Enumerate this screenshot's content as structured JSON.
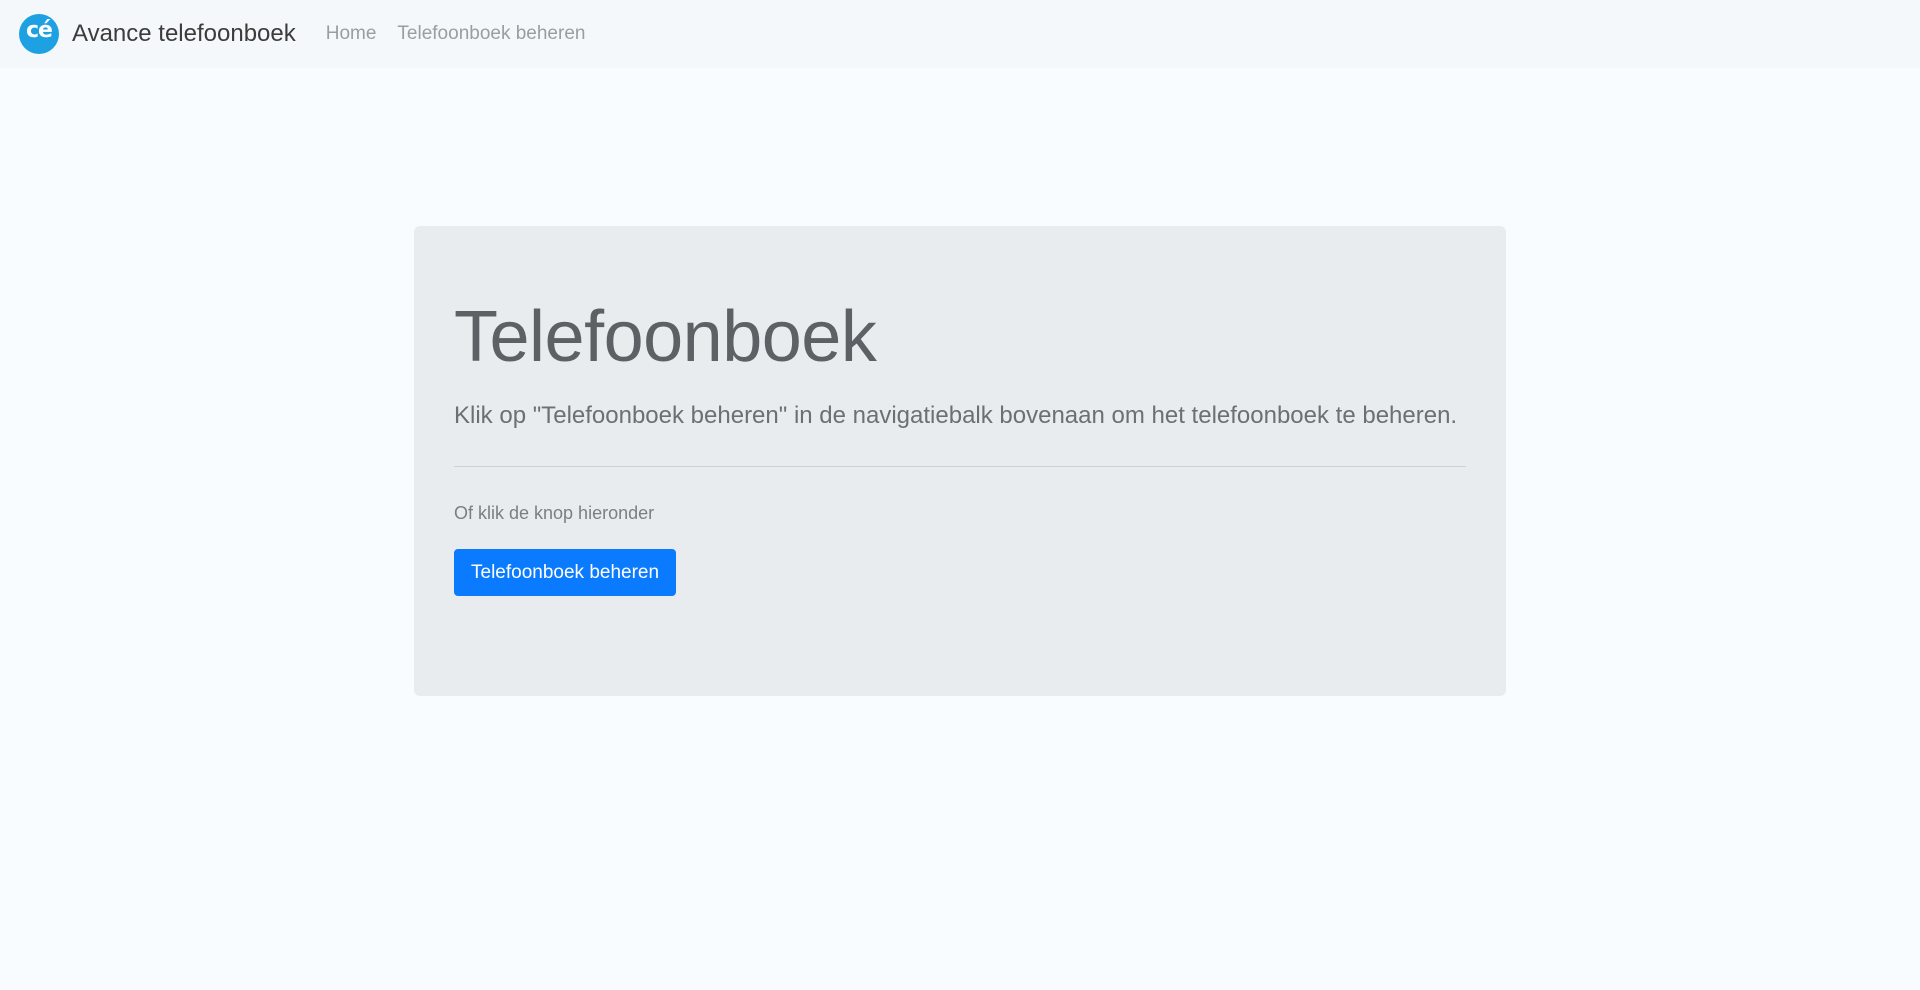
{
  "navbar": {
    "logo_text": "cé",
    "brand": "Avance telefoonboek",
    "links": [
      {
        "label": "Home"
      },
      {
        "label": "Telefoonboek beheren"
      }
    ]
  },
  "jumbotron": {
    "title": "Telefoonboek",
    "lead": "Klik op \"Telefoonboek beheren\" in de navigatiebalk bovenaan om het telefoonboek te beheren.",
    "hint": "Of klik de knop hieronder",
    "button_label": "Telefoonboek beheren"
  },
  "colors": {
    "logo": "#1da1e2",
    "primary_button": "#0a7bff",
    "jumbotron_bg": "#e9ecef",
    "page_bg": "#f9fcfe"
  }
}
